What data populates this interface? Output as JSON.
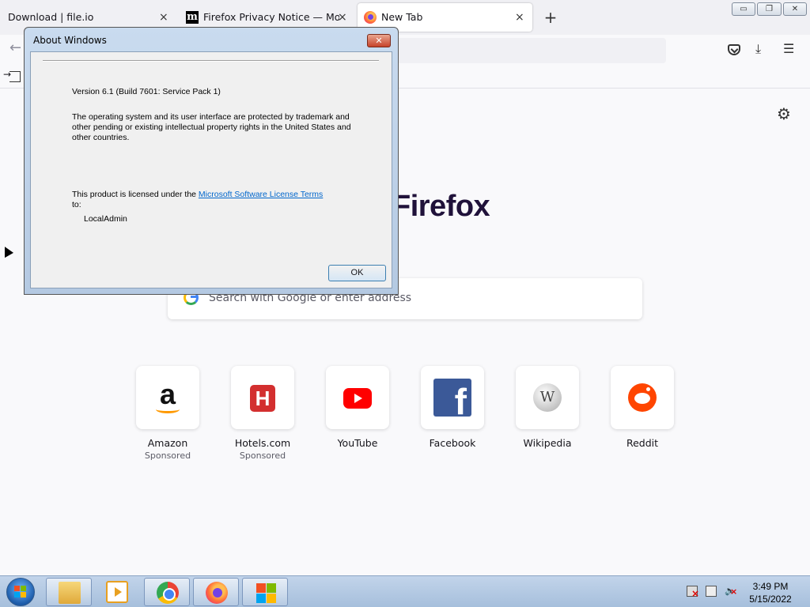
{
  "browser": {
    "tabs": [
      {
        "label": "Download | file.io",
        "close": "×"
      },
      {
        "favicon": "m",
        "label": "Firefox Privacy Notice — Mozilla",
        "close": "×"
      },
      {
        "label": "New Tab",
        "close": "×",
        "active": true
      }
    ],
    "new_tab": "+",
    "window_controls": {
      "minimize": "▭",
      "maximize": "❐",
      "close": "✕"
    },
    "nav": {
      "back": "←",
      "pocket": "pocket-icon",
      "download": "⤓",
      "menu": "☰"
    },
    "bookmarks": {
      "signin": "signin-icon"
    }
  },
  "newtab": {
    "settings": "⚙",
    "wordmark": "Firefox",
    "search": {
      "placeholder": "Search with Google or enter address"
    },
    "shortcuts": [
      {
        "title": "Amazon",
        "sub": "Sponsored",
        "glyph": "a"
      },
      {
        "title": "Hotels.com",
        "sub": "Sponsored",
        "glyph": "H"
      },
      {
        "title": "YouTube"
      },
      {
        "title": "Facebook",
        "glyph": "f"
      },
      {
        "title": "Wikipedia",
        "glyph": "W"
      },
      {
        "title": "Reddit"
      }
    ]
  },
  "about_dialog": {
    "title": "About Windows",
    "close": "✕",
    "version": "Version 6.1 (Build 7601: Service Pack 1)",
    "trademark": "The  operating system and its user interface are protected by trademark and other pending or existing intellectual property rights in the United States and other countries.",
    "license_prefix": "This product is licensed under the ",
    "license_link": "Microsoft Software License Terms",
    "license_suffix": " to:",
    "user": "LocalAdmin",
    "ok": "OK"
  },
  "taskbar": {
    "clock": {
      "time": "3:49 PM",
      "date": "5/15/2022"
    },
    "colors": {
      "accent": "#a6bfdc"
    }
  }
}
